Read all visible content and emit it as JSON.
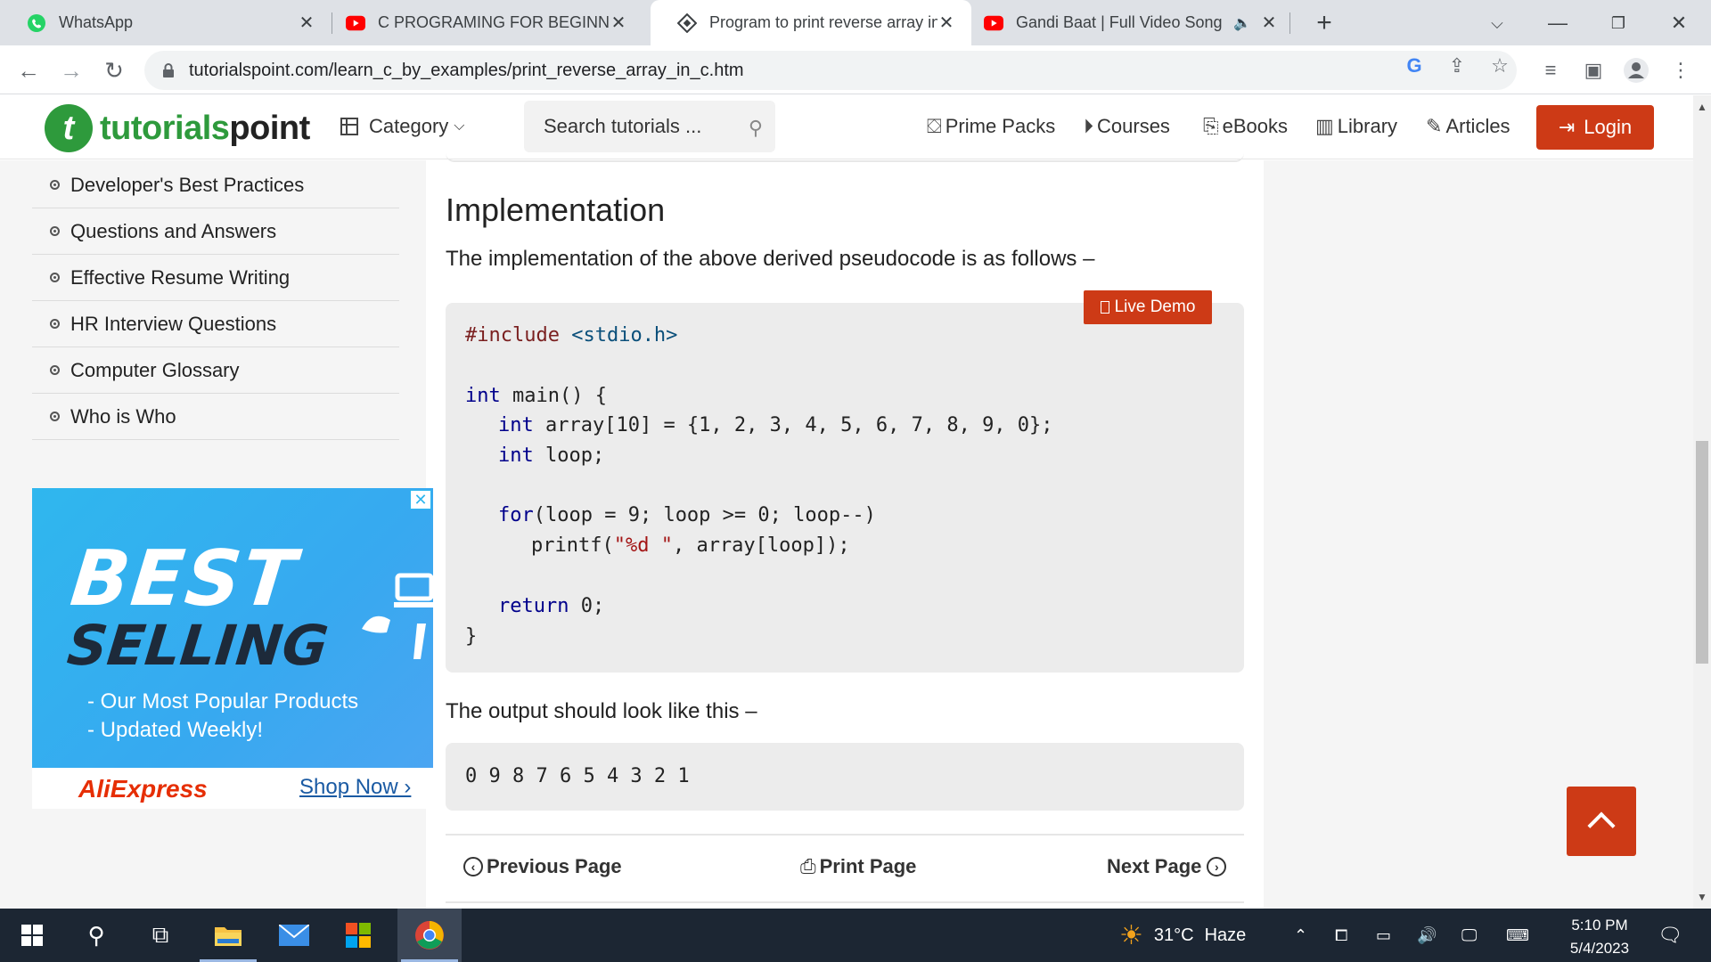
{
  "browser": {
    "tabs": [
      {
        "title": "WhatsApp",
        "active": false
      },
      {
        "title": "C PROGRAMING FOR BEGINNERS",
        "active": false
      },
      {
        "title": "Program to print reverse array in C",
        "active": true
      },
      {
        "title": "Gandi Baat | Full Video Song",
        "active": false
      }
    ],
    "url": "tutorialspoint.com/learn_c_by_examples/print_reverse_array_in_c.htm"
  },
  "site": {
    "logo": {
      "part1": "tutorials",
      "part2": "point"
    },
    "category_label": "Category",
    "search_placeholder": "Search tutorials ...",
    "nav": {
      "prime_packs": "Prime Packs",
      "courses": "Courses",
      "ebooks": "eBooks",
      "library": "Library",
      "articles": "Articles",
      "login": "Login"
    }
  },
  "sidebar": {
    "items": [
      {
        "label": "Developer's Best Practices"
      },
      {
        "label": "Questions and Answers"
      },
      {
        "label": "Effective Resume Writing"
      },
      {
        "label": "HR Interview Questions"
      },
      {
        "label": "Computer Glossary"
      },
      {
        "label": "Who is Who"
      }
    ]
  },
  "ad": {
    "headline1": "BEST",
    "headline2": "SELLING",
    "line1": "- Our Most Popular Products",
    "line2": "- Updated Weekly!",
    "brand": "AliExpress",
    "cta": "Shop Now ›"
  },
  "content": {
    "heading": "Implementation",
    "intro": "The implementation of the above derived pseudocode is as follows –",
    "live_demo": "Live Demo",
    "code": {
      "include_kw": "#include",
      "include_file": "<stdio.h>",
      "main_line": "int main() {",
      "array_kw": "int",
      "array_decl": " array[10] = {1, 2, 3, 4, 5, 6, 7, 8, 9, 0};",
      "loop_kw": "int",
      "loop_decl": " loop;",
      "for_kw": "for",
      "for_rest": "(loop = 9; loop >= 0; loop--)",
      "printf_fn": "printf(",
      "printf_str": "\"%d \"",
      "printf_rest": ", array[loop]);",
      "return_kw": "return",
      "return_rest": " 0;",
      "close": "}"
    },
    "output_intro": "The output should look like this –",
    "output": "0 9 8 7 6 5 4 3 2 1",
    "prev": "Previous Page",
    "print": "Print Page",
    "next": "Next Page"
  },
  "taskbar": {
    "weather_temp": "31°C",
    "weather_desc": "Haze",
    "time": "5:10 PM",
    "date": "5/4/2023"
  },
  "colors": {
    "brand_green": "#2e9a3c",
    "accent_red": "#cd3a16",
    "tabbar_bg": "#dee1e6",
    "taskbar_bg": "#1c2633"
  }
}
